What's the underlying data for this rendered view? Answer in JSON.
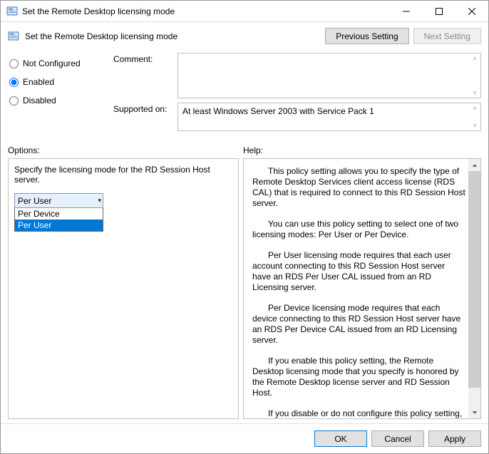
{
  "window": {
    "title": "Set the Remote Desktop licensing mode"
  },
  "subheader": {
    "title": "Set the Remote Desktop licensing mode",
    "previous": "Previous Setting",
    "next": "Next Setting"
  },
  "state": {
    "not_configured": "Not Configured",
    "enabled": "Enabled",
    "disabled": "Disabled",
    "selected": "Enabled"
  },
  "fields": {
    "comment_label": "Comment:",
    "comment_value": "",
    "supported_label": "Supported on:",
    "supported_value": "At least Windows Server 2003 with Service Pack 1"
  },
  "panels": {
    "options_label": "Options:",
    "help_label": "Help:"
  },
  "options": {
    "prompt": "Specify the licensing mode for the RD Session Host server.",
    "selected": "Per User",
    "items": [
      "Per Device",
      "Per User"
    ],
    "highlighted_index": 1
  },
  "help": {
    "p1": "This policy setting allows you to specify the type of Remote Desktop Services client access license (RDS CAL) that is required to connect to this RD Session Host server.",
    "p2": "You can use this policy setting to select one of two licensing modes: Per User or Per Device.",
    "p3": "Per User licensing mode requires that each user account connecting to this RD Session Host server have an RDS Per User CAL issued from an RD Licensing server.",
    "p4": "Per Device licensing mode requires that each device connecting to this RD Session Host server have an RDS Per Device CAL issued from an RD Licensing server.",
    "p5": "If you enable this policy setting, the Remote Desktop licensing mode that you specify is honored by the Remote Desktop license server and RD Session Host.",
    "p6": "If you disable or do not configure this policy setting, the"
  },
  "footer": {
    "ok": "OK",
    "cancel": "Cancel",
    "apply": "Apply"
  }
}
